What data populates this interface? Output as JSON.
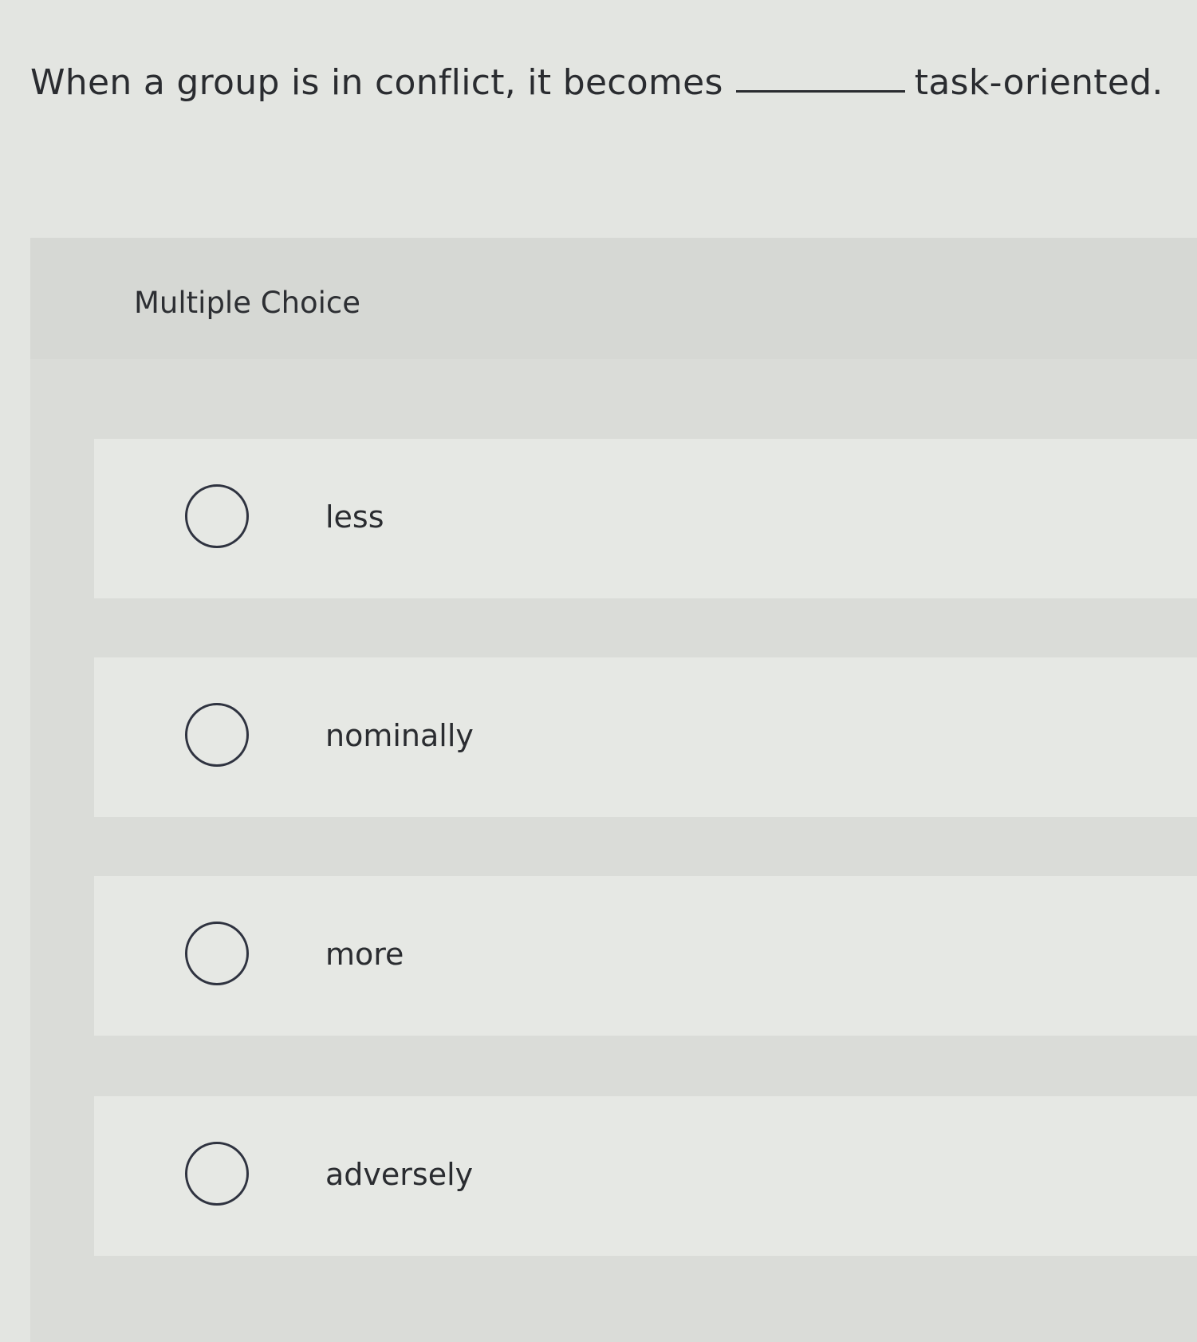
{
  "question": {
    "before_blank": "When a group is in conflict, it becomes",
    "after_blank": "task-oriented."
  },
  "section": {
    "title": "Multiple Choice"
  },
  "options": [
    {
      "label": "less",
      "selected": false
    },
    {
      "label": "nominally",
      "selected": false
    },
    {
      "label": "more",
      "selected": false
    },
    {
      "label": "adversely",
      "selected": false
    }
  ]
}
